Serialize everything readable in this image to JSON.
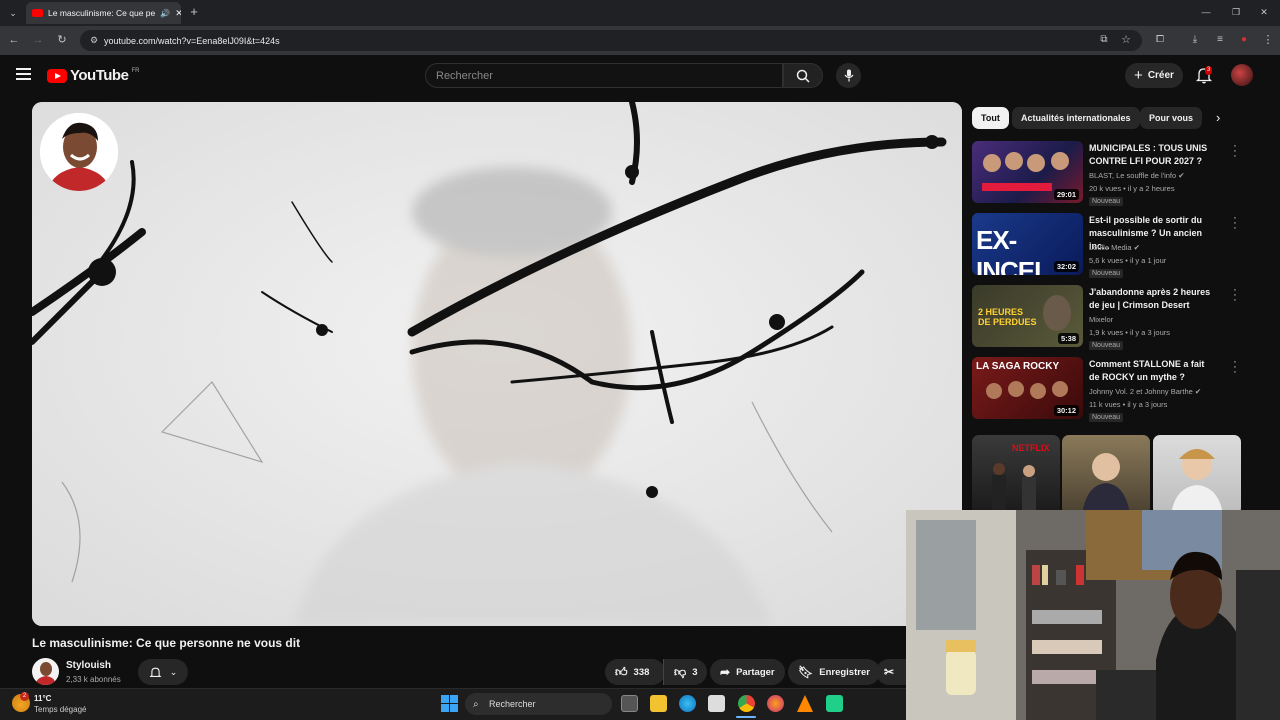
{
  "browser": {
    "tab_title": "Le masculinisme: Ce que pe",
    "url": "youtube.com/watch?v=Eena8elJ09I&t=424s"
  },
  "header": {
    "logo_text": "YouTube",
    "logo_country": "FR",
    "search_placeholder": "Rechercher",
    "create_label": "Créer",
    "notification_count": "3"
  },
  "video": {
    "title": "Le masculinisme: Ce que personne ne vous dit",
    "channel_name": "Stylouish",
    "channel_subs": "2,33 k abonnés",
    "likes": "338",
    "dislikes": "3",
    "share_label": "Partager",
    "save_label": "Enregistrer"
  },
  "chips": [
    "Tout",
    "Actualités internationales",
    "Pour vous"
  ],
  "recommendations": [
    {
      "title": "MUNICIPALES : TOUS UNIS CONTRE LFI POUR 2027 ?",
      "channel": "BLAST, Le souffle de l'info",
      "verified": true,
      "meta": "20 k vues • il y a 2 heures",
      "badge": "Nouveau",
      "duration": "29:01",
      "thumb_text": "MUNICIPALES"
    },
    {
      "title": "Est-il possible de sortir du masculinisme ? Un ancien inc...",
      "channel": "Loulle Media",
      "verified": true,
      "meta": "5,6 k vues • il y a 1 jour",
      "badge": "Nouveau",
      "duration": "32:02",
      "thumb_text": "EX-INCEL"
    },
    {
      "title": "J'abandonne après 2 heures de jeu | Crimson Desert",
      "channel": "Mixelor",
      "verified": false,
      "meta": "1,9 k vues • il y a 3 jours",
      "badge": "Nouveau",
      "duration": "5:38",
      "thumb_text": "2 HEURES DE PERDUES"
    },
    {
      "title": "Comment STALLONE a fait de ROCKY un mythe ?",
      "channel": "Johnny Vol. 2 et Johnny Barthe",
      "verified": true,
      "meta": "11 k vues • il y a 3 jours",
      "badge": "Nouveau",
      "duration": "30:12",
      "thumb_text": "LA SAGA ROCKY"
    }
  ],
  "shorts": [
    {
      "label": "NETFLIX"
    },
    {
      "label": ""
    },
    {
      "label": ""
    }
  ],
  "taskbar": {
    "weather_temp": "11°C",
    "weather_desc": "Temps dégagé",
    "search_label": "Rechercher",
    "weather_badge": "2"
  },
  "colors": {
    "accent": "#ff0000",
    "background": "#0f0f0f",
    "chip_bg": "#272727"
  }
}
